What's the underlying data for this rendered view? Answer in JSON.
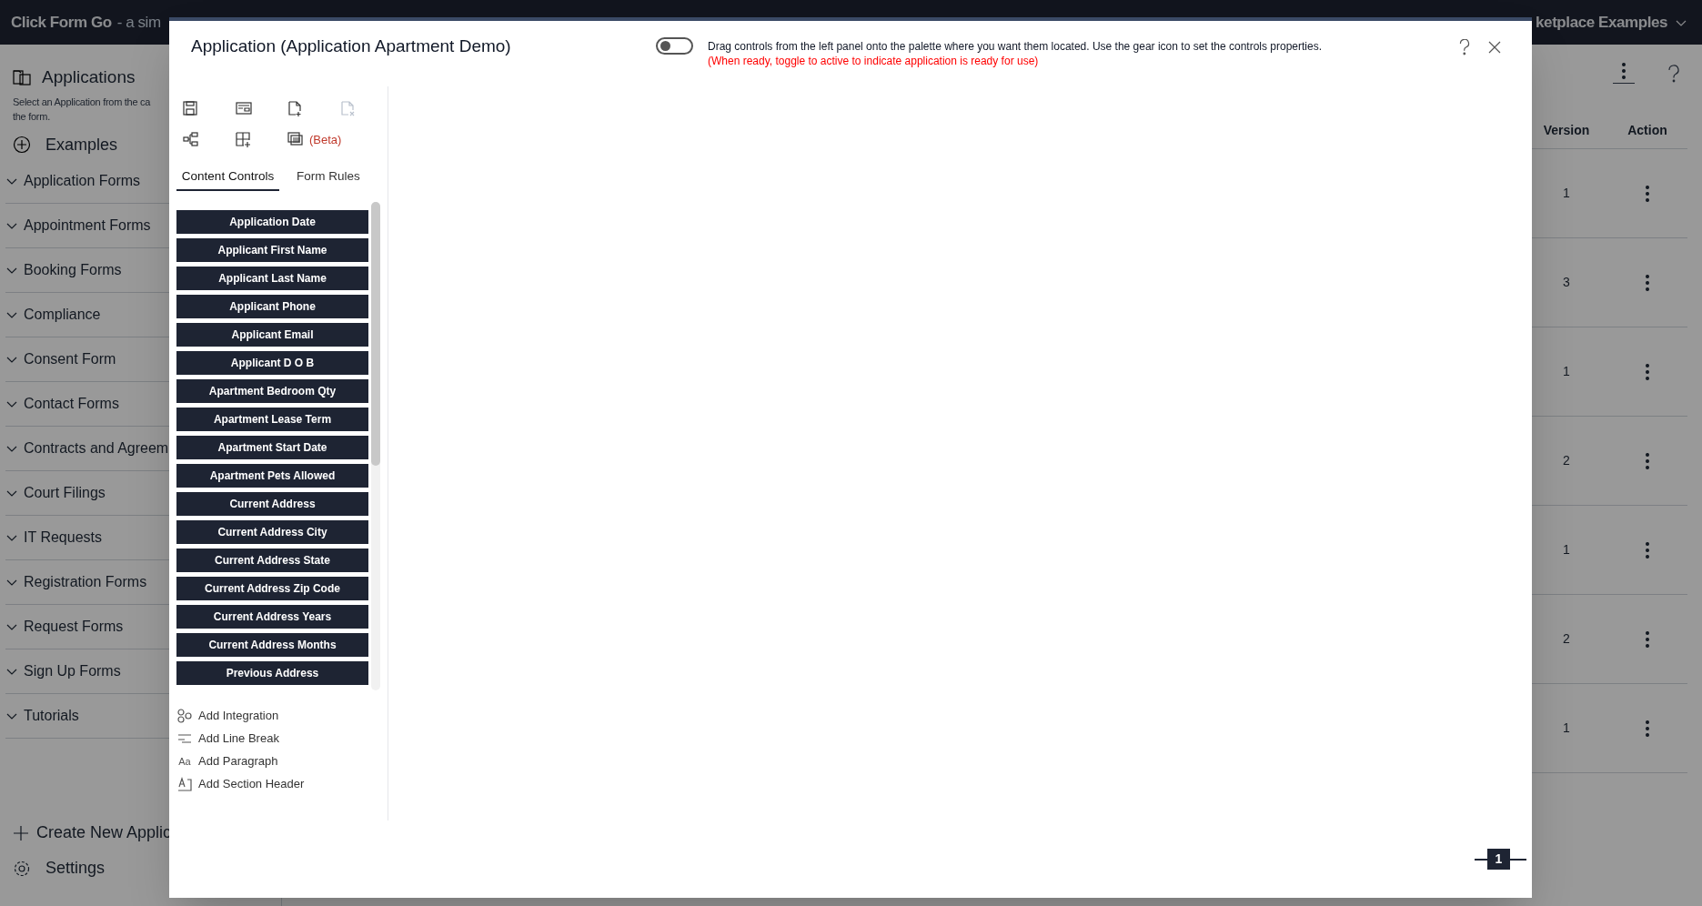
{
  "app_header": {
    "title": "Click Form Go",
    "subtitle": "- a sim",
    "right_menu": "ketplace Examples"
  },
  "sidebar": {
    "heading": "Applications",
    "description": [
      "Select an Application from the ca",
      "the form."
    ],
    "examples": "Examples",
    "groups": [
      "Application Forms",
      "Appointment Forms",
      "Booking Forms",
      "Compliance",
      "Consent Form",
      "Contact Forms",
      "Contracts and Agreem",
      "Court Filings",
      "IT Requests",
      "Registration Forms",
      "Request Forms",
      "Sign Up Forms",
      "Tutorials"
    ],
    "create_button": "Create New Applic",
    "settings": "Settings"
  },
  "table": {
    "columns": [
      "Version",
      "Action"
    ],
    "rows": [
      {
        "version": "1"
      },
      {
        "version": "3"
      },
      {
        "version": "1"
      },
      {
        "version": "2"
      },
      {
        "version": "1"
      },
      {
        "version": "2"
      },
      {
        "version": "1"
      }
    ]
  },
  "modal": {
    "title": "Application (Application Apartment Demo)",
    "active": false,
    "instructions": "Drag controls from the left panel onto the palette where you want them located. Use the gear icon to set the controls properties.",
    "note": "(When ready, toggle to active to indicate application is ready for use)",
    "toolbar": [
      {
        "kind": "save",
        "disabled": false
      },
      {
        "kind": "form",
        "disabled": false
      },
      {
        "kind": "new-file",
        "disabled": false
      },
      {
        "kind": "delete-file",
        "disabled": true
      },
      {
        "kind": "flow",
        "disabled": false
      },
      {
        "kind": "add-grid",
        "disabled": false
      },
      {
        "kind": "documents",
        "disabled": false,
        "label": "(Beta)"
      }
    ],
    "tabs": [
      {
        "label": "Content Controls",
        "selected": true
      },
      {
        "label": "Form Rules",
        "selected": false
      }
    ],
    "controls": [
      "Application Date",
      "Applicant First Name",
      "Applicant Last Name",
      "Applicant Phone",
      "Applicant Email",
      "Applicant D O B",
      "Apartment Bedroom Qty",
      "Apartment Lease Term",
      "Apartment Start Date",
      "Apartment Pets Allowed",
      "Current Address",
      "Current Address City",
      "Current Address State",
      "Current Address Zip Code",
      "Current Address Years",
      "Current Address Months",
      "Previous Address"
    ],
    "tools": [
      {
        "kind": "integration",
        "label": "Add Integration"
      },
      {
        "kind": "line-break",
        "label": "Add Line Break"
      },
      {
        "kind": "paragraph",
        "glyph": "Aa",
        "label": "Add Paragraph"
      },
      {
        "kind": "section-header",
        "label": "Add Section Header"
      }
    ],
    "page": "1"
  }
}
